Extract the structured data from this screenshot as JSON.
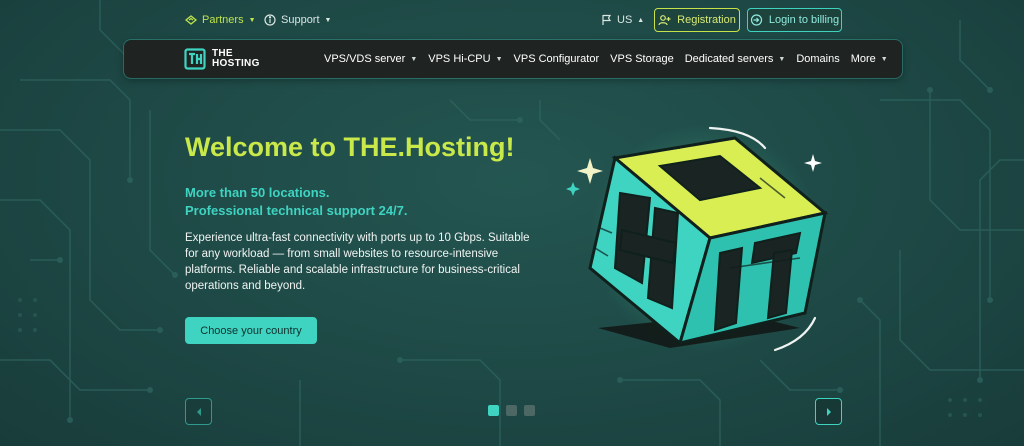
{
  "topbar": {
    "partners": "Partners",
    "support": "Support",
    "language": "US",
    "registration": "Registration",
    "login": "Login to billing"
  },
  "nav": {
    "logo_line1": "THE",
    "logo_line2": "HOSTING",
    "items": [
      {
        "label": "VPS/VDS server",
        "dropdown": true
      },
      {
        "label": "VPS Hi-CPU",
        "dropdown": true
      },
      {
        "label": "VPS Configurator",
        "dropdown": false
      },
      {
        "label": "VPS Storage",
        "dropdown": false
      },
      {
        "label": "Dedicated servers",
        "dropdown": true
      },
      {
        "label": "Domains",
        "dropdown": false
      },
      {
        "label": "More",
        "dropdown": true
      }
    ]
  },
  "hero": {
    "title": "Welcome to THE.Hosting!",
    "subtitle_line1": "More than 50 locations.",
    "subtitle_line2": "Professional technical support 24/7.",
    "description": "Experience ultra-fast connectivity with ports up to 10 Gbps. Suitable for any workload — from small websites to resource-intensive platforms. Reliable and scalable infrastructure for business-critical operations and beyond.",
    "cta": "Choose your country"
  },
  "carousel": {
    "slides": 3,
    "active": 0
  },
  "colors": {
    "accent_lime": "#c9e94a",
    "accent_teal": "#3fd3c1",
    "background": "#1e4a47",
    "nav_bg": "#1f2422"
  },
  "icons": [
    "partners-icon",
    "info-icon",
    "flag-icon",
    "add-user-icon",
    "login-icon",
    "logo-icon",
    "chevron-left-icon",
    "chevron-right-icon",
    "sparkle-icon"
  ]
}
